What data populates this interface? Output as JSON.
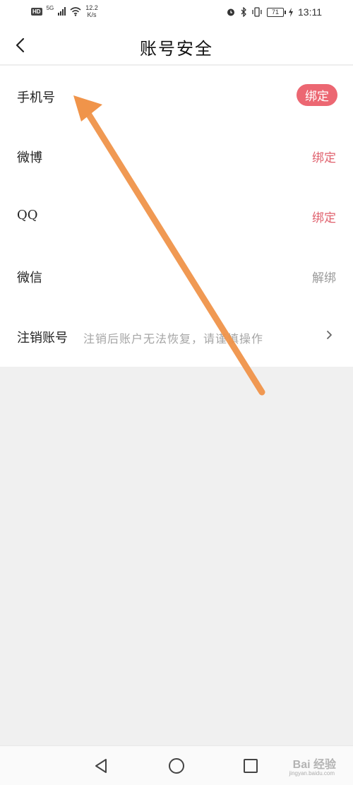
{
  "status_bar": {
    "hd": "HD",
    "network": "5G",
    "speed_value": "12.2",
    "speed_unit": "K/s",
    "battery": "71",
    "time": "13:11"
  },
  "header": {
    "title": "账号安全"
  },
  "rows": [
    {
      "label": "手机号",
      "action": "绑定"
    },
    {
      "label": "微博",
      "action": "绑定"
    },
    {
      "label": "QQ",
      "action": "绑定"
    },
    {
      "label": "微信",
      "action": "解绑"
    },
    {
      "label": "注销账号",
      "description": "注销后账户无法恢复，请谨慎操作"
    }
  ],
  "colors": {
    "accent_red": "#e0626e",
    "pill_red": "#ec6772",
    "annotation_arrow": "#f0944a"
  },
  "icons": {
    "back": "chevron-left-icon",
    "row_more": "chevron-right-icon",
    "nav_back": "triangle-back-icon",
    "nav_home": "circle-home-icon",
    "nav_recent": "square-recent-icon"
  },
  "watermark": {
    "brand": "Bai 经验",
    "domain": "jingyan.baidu.com"
  }
}
